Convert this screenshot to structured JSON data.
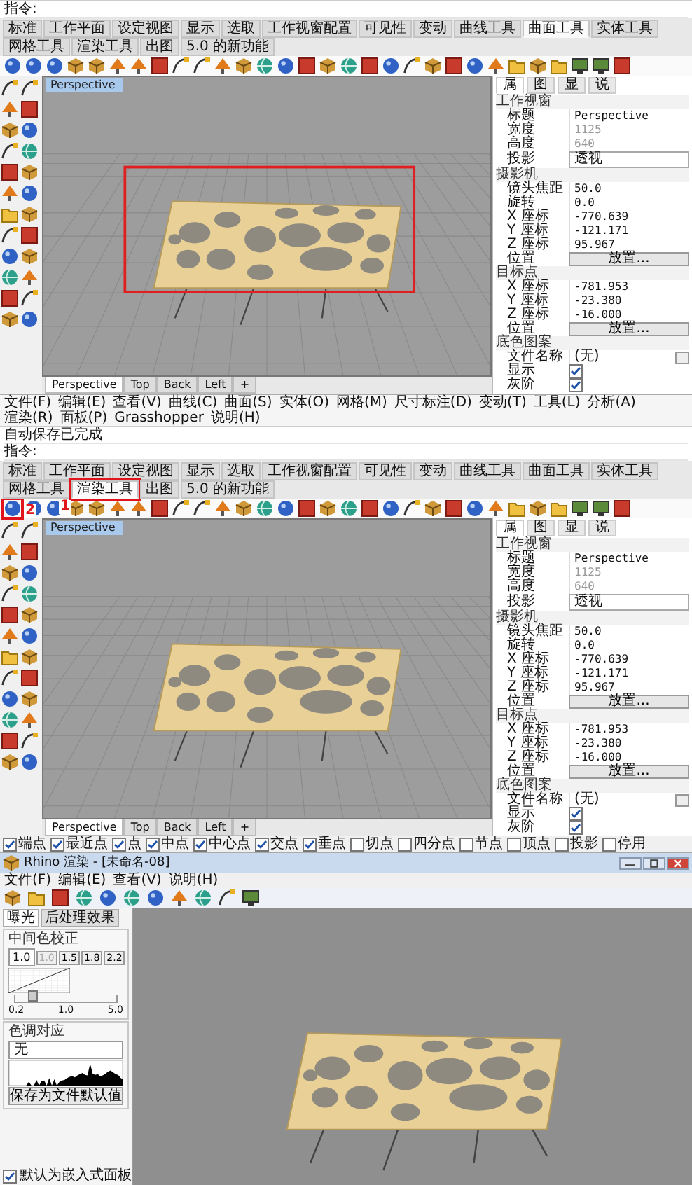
{
  "cad_windows": [
    {
      "command_lines": [
        "指令:"
      ],
      "toolbar_tabs": [
        {
          "label": "标准",
          "selected": false
        },
        {
          "label": "工作平面",
          "selected": false
        },
        {
          "label": "设定视图",
          "selected": false
        },
        {
          "label": "显示",
          "selected": false
        },
        {
          "label": "选取",
          "selected": false
        },
        {
          "label": "工作视窗配置",
          "selected": false
        },
        {
          "label": "可见性",
          "selected": false
        },
        {
          "label": "变动",
          "selected": false
        },
        {
          "label": "曲线工具",
          "selected": false
        },
        {
          "label": "曲面工具",
          "selected": true
        },
        {
          "label": "实体工具",
          "selected": false
        },
        {
          "label": "网格工具",
          "selected": false
        },
        {
          "label": "渲染工具",
          "selected": false
        },
        {
          "label": "出图",
          "selected": false
        },
        {
          "label": "5.0 的新功能",
          "selected": false
        }
      ],
      "viewport": {
        "title": "Perspective",
        "highlighted": true
      },
      "viewport_tabs": [
        {
          "label": "Perspective",
          "selected": true
        },
        {
          "label": "Top",
          "selected": false
        },
        {
          "label": "Back",
          "selected": false
        },
        {
          "label": "Left",
          "selected": false
        },
        {
          "label": "+",
          "selected": false
        }
      ],
      "properties": {
        "tabs": [
          {
            "label": "属",
            "selected": true
          },
          {
            "label": "图",
            "selected": false
          },
          {
            "label": "显",
            "selected": false
          },
          {
            "label": "说",
            "selected": false
          }
        ],
        "sections": [
          {
            "title": "工作视窗",
            "rows": [
              {
                "label": "标题",
                "kind": "text",
                "value": "Perspective",
                "disabled": false
              },
              {
                "label": "宽度",
                "kind": "text",
                "value": "1125",
                "disabled": true
              },
              {
                "label": "高度",
                "kind": "text",
                "value": "640",
                "disabled": true
              },
              {
                "label": "投影",
                "kind": "dropdown",
                "value": "透视",
                "disabled": false
              }
            ]
          },
          {
            "title": "摄影机",
            "rows": [
              {
                "label": "镜头焦距",
                "kind": "text",
                "value": "50.0",
                "disabled": false
              },
              {
                "label": "旋转",
                "kind": "text",
                "value": "0.0",
                "disabled": false
              },
              {
                "label": "X 座标",
                "kind": "text",
                "value": "-770.639",
                "disabled": false
              },
              {
                "label": "Y 座标",
                "kind": "text",
                "value": "-121.171",
                "disabled": false
              },
              {
                "label": "Z 座标",
                "kind": "text",
                "value": "95.967",
                "disabled": false
              },
              {
                "label": "位置",
                "kind": "button",
                "value": "放置...",
                "disabled": false
              }
            ]
          },
          {
            "title": "目标点",
            "rows": [
              {
                "label": "X 座标",
                "kind": "text",
                "value": "-781.953",
                "disabled": false
              },
              {
                "label": "Y 座标",
                "kind": "text",
                "value": "-23.380",
                "disabled": false
              },
              {
                "label": "Z 座标",
                "kind": "text",
                "value": "-16.000",
                "disabled": false
              },
              {
                "label": "位置",
                "kind": "button",
                "value": "放置...",
                "disabled": false
              }
            ]
          },
          {
            "title": "底色图案",
            "rows": [
              {
                "label": "文件名称",
                "kind": "file",
                "value": "(无)",
                "disabled": false
              },
              {
                "label": "显示",
                "kind": "checkbox",
                "checked": true,
                "disabled": false
              },
              {
                "label": "灰阶",
                "kind": "checkbox",
                "checked": true,
                "disabled": false
              }
            ]
          }
        ]
      }
    },
    {
      "menu": [
        "文件(F)",
        "编辑(E)",
        "查看(V)",
        "曲线(C)",
        "曲面(S)",
        "实体(O)",
        "网格(M)",
        "尺寸标注(D)",
        "变动(T)",
        "工具(L)",
        "分析(A)",
        "渲染(R)",
        "面板(P)",
        "Grasshopper",
        "说明(H)"
      ],
      "command_lines": [
        "自动保存已完成",
        "指令:"
      ],
      "toolbar_tabs": [
        {
          "label": "标准",
          "selected": false
        },
        {
          "label": "工作平面",
          "selected": false
        },
        {
          "label": "设定视图",
          "selected": false
        },
        {
          "label": "显示",
          "selected": false
        },
        {
          "label": "选取",
          "selected": false
        },
        {
          "label": "工作视窗配置",
          "selected": false
        },
        {
          "label": "可见性",
          "selected": false
        },
        {
          "label": "变动",
          "selected": false
        },
        {
          "label": "曲线工具",
          "selected": false
        },
        {
          "label": "曲面工具",
          "selected": false
        },
        {
          "label": "实体工具",
          "selected": false
        },
        {
          "label": "网格工具",
          "selected": false
        },
        {
          "label": "渲染工具",
          "selected": true,
          "callout": "1"
        },
        {
          "label": "出图",
          "selected": false
        },
        {
          "label": "5.0 的新功能",
          "selected": false
        }
      ],
      "toolbar": {
        "callout": "2"
      },
      "viewport": {
        "title": "Perspective",
        "highlighted": false
      },
      "viewport_tabs": [
        {
          "label": "Perspective",
          "selected": true
        },
        {
          "label": "Top",
          "selected": false
        },
        {
          "label": "Back",
          "selected": false
        },
        {
          "label": "Left",
          "selected": false
        },
        {
          "label": "+",
          "selected": false
        }
      ],
      "properties": {
        "tabs": [
          {
            "label": "属",
            "selected": true
          },
          {
            "label": "图",
            "selected": false
          },
          {
            "label": "显",
            "selected": false
          },
          {
            "label": "说",
            "selected": false
          }
        ],
        "sections": [
          {
            "title": "工作视窗",
            "rows": [
              {
                "label": "标题",
                "kind": "text",
                "value": "Perspective",
                "disabled": false
              },
              {
                "label": "宽度",
                "kind": "text",
                "value": "1125",
                "disabled": true
              },
              {
                "label": "高度",
                "kind": "text",
                "value": "640",
                "disabled": true
              },
              {
                "label": "投影",
                "kind": "dropdown",
                "value": "透视",
                "disabled": false
              }
            ]
          },
          {
            "title": "摄影机",
            "rows": [
              {
                "label": "镜头焦距",
                "kind": "text",
                "value": "50.0",
                "disabled": false
              },
              {
                "label": "旋转",
                "kind": "text",
                "value": "0.0",
                "disabled": false
              },
              {
                "label": "X 座标",
                "kind": "text",
                "value": "-770.639",
                "disabled": false
              },
              {
                "label": "Y 座标",
                "kind": "text",
                "value": "-121.171",
                "disabled": false
              },
              {
                "label": "Z 座标",
                "kind": "text",
                "value": "95.967",
                "disabled": false
              },
              {
                "label": "位置",
                "kind": "button",
                "value": "放置...",
                "disabled": false
              }
            ]
          },
          {
            "title": "目标点",
            "rows": [
              {
                "label": "X 座标",
                "kind": "text",
                "value": "-781.953",
                "disabled": false
              },
              {
                "label": "Y 座标",
                "kind": "text",
                "value": "-23.380",
                "disabled": false
              },
              {
                "label": "Z 座标",
                "kind": "text",
                "value": "-16.000",
                "disabled": false
              },
              {
                "label": "位置",
                "kind": "button",
                "value": "放置...",
                "disabled": false
              }
            ]
          },
          {
            "title": "底色图案",
            "rows": [
              {
                "label": "文件名称",
                "kind": "file",
                "value": "(无)",
                "disabled": false
              },
              {
                "label": "显示",
                "kind": "checkbox",
                "checked": true,
                "disabled": false
              },
              {
                "label": "灰阶",
                "kind": "checkbox",
                "checked": true,
                "disabled": false
              }
            ]
          }
        ]
      },
      "osnaps": [
        {
          "label": "端点",
          "checked": true
        },
        {
          "label": "最近点",
          "checked": true
        },
        {
          "label": "点",
          "checked": true
        },
        {
          "label": "中点",
          "checked": true
        },
        {
          "label": "中心点",
          "checked": true
        },
        {
          "label": "交点",
          "checked": true
        },
        {
          "label": "垂点",
          "checked": true
        },
        {
          "label": "切点",
          "checked": false
        },
        {
          "label": "四分点",
          "checked": false
        },
        {
          "label": "节点",
          "checked": false
        },
        {
          "label": "顶点",
          "checked": false
        },
        {
          "label": "投影",
          "checked": false
        },
        {
          "label": "停用",
          "checked": false
        }
      ]
    }
  ],
  "render_window": {
    "title": "Rhino 渲染 - [未命名-08]",
    "menu": [
      "文件(F)",
      "编辑(E)",
      "查看(V)",
      "说明(H)"
    ],
    "panel_tabs": [
      {
        "label": "曝光",
        "selected": true
      },
      {
        "label": "后处理效果",
        "selected": false
      }
    ],
    "gamma": {
      "title": "中间色校正",
      "value": "1.0",
      "presets": [
        {
          "label": "1.0",
          "disabled": true
        },
        {
          "label": "1.5",
          "disabled": false
        },
        {
          "label": "1.8",
          "disabled": false
        },
        {
          "label": "2.2",
          "disabled": false
        }
      ],
      "level": 0.17,
      "scale_labels": [
        "0.2",
        "1.0",
        "5.0"
      ]
    },
    "tone_mapping": {
      "title": "色调对应",
      "value": "无"
    },
    "save_button": "保存为文件默认值",
    "embed_option": {
      "label": "默认为嵌入式面板",
      "checked": true
    }
  }
}
